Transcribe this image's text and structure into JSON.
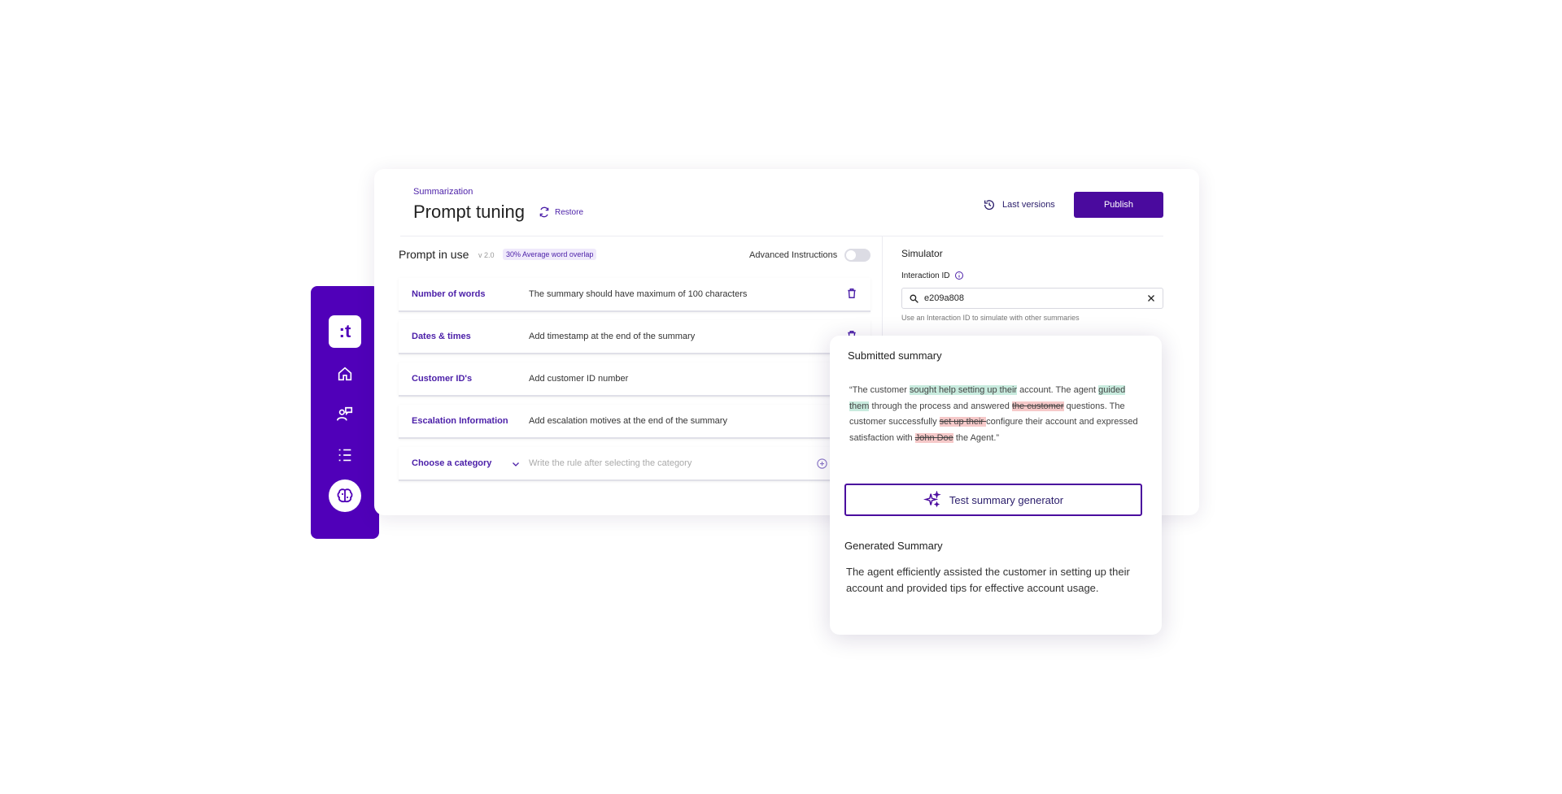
{
  "colors": {
    "brand": "#5000b9",
    "accent": "#4a0a9e",
    "added": "#c8ebde",
    "removed": "#f6c9c9"
  },
  "sidebar": {
    "logo": ":t",
    "items": [
      {
        "icon": "home-icon"
      },
      {
        "icon": "agent-chat-icon"
      },
      {
        "icon": "list-icon"
      },
      {
        "icon": "brain-icon",
        "active": true
      }
    ]
  },
  "header": {
    "breadcrumb": "Summarization",
    "title": "Prompt tuning",
    "restore_label": "Restore",
    "last_versions_label": "Last versions",
    "publish_label": "Publish"
  },
  "prompt": {
    "title": "Prompt in use",
    "version": "v 2.0",
    "overlap_badge": "30% Average word overlap",
    "advanced_label": "Advanced Instructions",
    "advanced_enabled": false,
    "rules": [
      {
        "name": "Number of words",
        "desc": "The summary should have maximum of 100 characters"
      },
      {
        "name": "Dates & times",
        "desc": "Add timestamp at the end of the summary"
      },
      {
        "name": "Customer ID's",
        "desc": "Add customer ID number"
      },
      {
        "name": "Escalation Information",
        "desc": "Add escalation motives at the end of the summary"
      }
    ],
    "new_rule": {
      "select_label": "Choose a category",
      "placeholder": "Write the rule after selecting the category"
    }
  },
  "simulator": {
    "title": "Simulator",
    "interaction_label": "Interaction ID",
    "interaction_value": "e209a808",
    "help": "Use an Interaction ID to simulate with other summaries"
  },
  "submitted": {
    "title": "Submitted summary",
    "segments": [
      {
        "t": "“The customer ",
        "k": "plain"
      },
      {
        "t": "sought help setting up their",
        "k": "added"
      },
      {
        "t": " account. The agent ",
        "k": "plain"
      },
      {
        "t": "guided them",
        "k": "added"
      },
      {
        "t": " through the process and answered ",
        "k": "plain"
      },
      {
        "t": "the customer",
        "k": "removed"
      },
      {
        "t": " questions. The customer successfully ",
        "k": "plain"
      },
      {
        "t": "set up their ",
        "k": "removed"
      },
      {
        "t": "configure their account and expressed satisfaction with ",
        "k": "plain"
      },
      {
        "t": "John Doe",
        "k": "removed"
      },
      {
        "t": " the Agent.”",
        "k": "plain"
      }
    ]
  },
  "test_button_label": "Test summary generator",
  "generated": {
    "title": "Generated Summary",
    "text": "The agent efficiently assisted the customer in setting up their account and provided tips for effective account usage."
  }
}
